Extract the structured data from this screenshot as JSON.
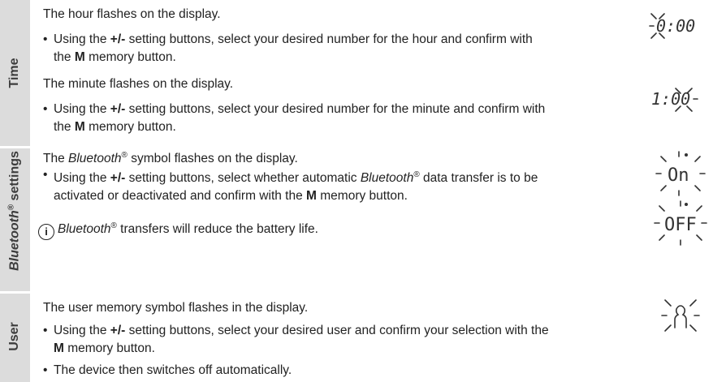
{
  "sections": {
    "time": {
      "label": "Time",
      "hour_intro": "The hour flashes on the display.",
      "hour_bullet_pre": "Using the ",
      "hour_bullet_btn": "+/-",
      "hour_bullet_mid": " setting buttons, select your desired number for the hour and confirm with",
      "hour_bullet_line2_pre": "the ",
      "hour_bullet_mem": "M",
      "hour_bullet_line2_post": " memory button.",
      "minute_intro": "The minute flashes on the display.",
      "minute_bullet_pre": "Using the ",
      "minute_bullet_btn": "+/-",
      "minute_bullet_mid": " setting buttons, select your desired number for the minute and confirm with",
      "minute_bullet_line2_pre": "the ",
      "minute_bullet_mem": "M",
      "minute_bullet_line2_post": " memory button."
    },
    "bluetooth": {
      "label_italic": "Bluetooth",
      "label_reg": "®",
      "label_rest": " settings",
      "intro_pre": "The ",
      "intro_bt": "Bluetooth",
      "intro_reg": "®",
      "intro_post": " symbol flashes on the display.",
      "bullet_pre": "Using the ",
      "bullet_btn": "+/-",
      "bullet_mid": " setting buttons, select whether automatic ",
      "bullet_bt": "Bluetooth",
      "bullet_reg": "®",
      "bullet_post": " data transfer is to be",
      "bullet_line2_pre": "activated or deactivated and confirm with the ",
      "bullet_mem": "M",
      "bullet_line2_post": " memory button.",
      "info_icon": "i",
      "info_bt": "Bluetooth",
      "info_reg": "®",
      "info_post": " transfers will reduce the battery life."
    },
    "user": {
      "label": "User",
      "intro": "The user memory symbol flashes in the display.",
      "bullet1_pre": "Using the ",
      "bullet1_btn": "+/-",
      "bullet1_mid": " setting buttons, select your desired user and confirm your selection with the",
      "bullet1_mem": "M",
      "bullet1_post": " memory button.",
      "bullet2": "The device then switches off automatically."
    }
  },
  "displays": {
    "hour": "0:00",
    "minute": "1:00",
    "bt_on": "On",
    "bt_off": "OFF"
  },
  "bullet_glyph": "•",
  "colors": {
    "sidebar": "#dcdcdc",
    "text": "#222222",
    "sidebar_text": "#3c3c3c"
  }
}
